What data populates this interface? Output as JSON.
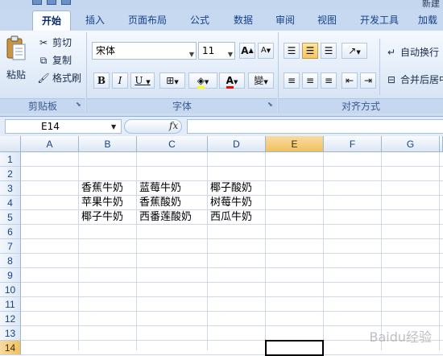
{
  "title_partial": "新建",
  "tabs": [
    {
      "label": "开始",
      "active": true
    },
    {
      "label": "插入"
    },
    {
      "label": "页面布局"
    },
    {
      "label": "公式"
    },
    {
      "label": "数据"
    },
    {
      "label": "审阅"
    },
    {
      "label": "视图"
    },
    {
      "label": "开发工具"
    },
    {
      "label": "加载"
    }
  ],
  "clipboard": {
    "group_label": "剪贴板",
    "paste": "粘贴",
    "cut": "剪切",
    "copy": "复制",
    "format_painter": "格式刷"
  },
  "font": {
    "group_label": "字体",
    "font_name": "宋体",
    "font_size": "11",
    "bold": "B",
    "italic": "I",
    "underline": "U",
    "grow": "A",
    "shrink": "A",
    "font_color_glyph": "A",
    "phonetic_glyph": "變"
  },
  "alignment": {
    "group_label": "对齐方式",
    "wrap_text": "自动换行",
    "merge_center": "合并后居中"
  },
  "formula_bar": {
    "name_box": "E14",
    "fx": "fx",
    "formula": ""
  },
  "sheet": {
    "columns": [
      "A",
      "B",
      "C",
      "D",
      "E",
      "F",
      "G"
    ],
    "selected_column": "E",
    "rows": [
      "1",
      "2",
      "3",
      "4",
      "5",
      "6",
      "7",
      "8",
      "9",
      "10",
      "11",
      "12",
      "13",
      "14"
    ],
    "selected_row": "14",
    "cells": {
      "B3": "香蕉牛奶",
      "C3": "蓝莓牛奶",
      "D3": "椰子酸奶",
      "B4": "苹果牛奶",
      "C4": "香蕉酸奶",
      "D4": "树莓牛奶",
      "B5": "椰子牛奶",
      "C5": "西番莲酸奶",
      "D5": "西瓜牛奶"
    }
  },
  "watermark": "Baidu经验"
}
